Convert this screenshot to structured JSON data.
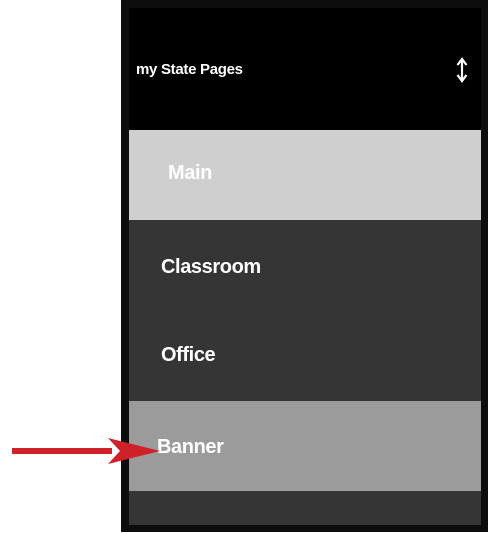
{
  "header": {
    "title": "my State Pages",
    "sort_icon": "up-down-arrow-icon"
  },
  "menu": {
    "items": [
      {
        "label": "Main",
        "state": "active"
      },
      {
        "label": "Classroom",
        "state": "normal"
      },
      {
        "label": "Office",
        "state": "normal"
      },
      {
        "label": "Banner",
        "state": "highlighted"
      }
    ]
  },
  "annotation": {
    "icon": "red-arrow-icon",
    "target": "Banner"
  },
  "colors": {
    "header_bg": "#000000",
    "list_bg": "#353535",
    "active_item_bg": "#cfcfcf",
    "highlighted_item_bg": "#9b9b9b",
    "arrow": "#d0202a"
  }
}
